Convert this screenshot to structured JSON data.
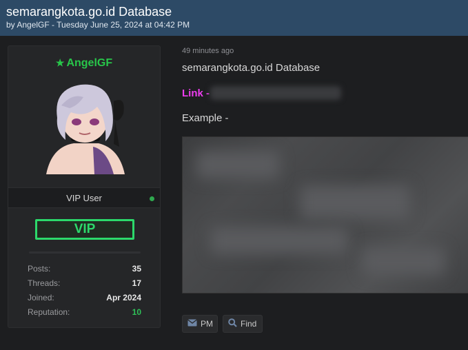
{
  "thread": {
    "title": "semarangkota.go.id Database",
    "meta": "by AngelGF - Tuesday June 25, 2024 at 04:42 PM"
  },
  "user": {
    "username": "AngelGF",
    "star_icon": "star-icon",
    "role": "VIP User",
    "badge": "VIP",
    "status_color": "#2fa84f",
    "stats": [
      {
        "label": "Posts:",
        "value": "35"
      },
      {
        "label": "Threads:",
        "value": "17"
      },
      {
        "label": "Joined:",
        "value": "Apr 2024"
      },
      {
        "label": "Reputation:",
        "value": "10"
      }
    ]
  },
  "post": {
    "time": "49 minutes ago",
    "title": "semarangkota.go.id Database",
    "link_label": "Link -",
    "example_label": "Example -"
  },
  "actions": {
    "pm": "PM",
    "find": "Find"
  },
  "colors": {
    "header_bg": "#2d4a66",
    "username": "#28c64a",
    "vip": "#2cd96b",
    "link": "#ee3df0",
    "reputation": "#2fc158"
  }
}
